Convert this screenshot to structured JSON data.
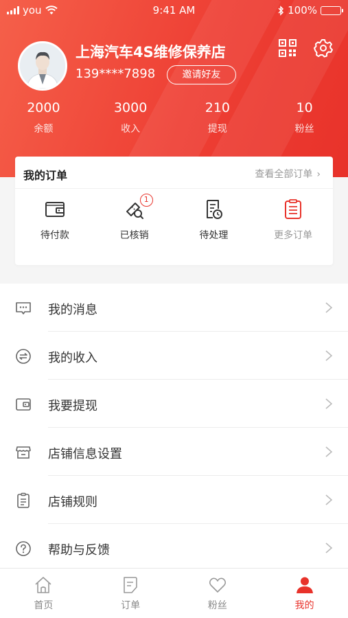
{
  "status_bar": {
    "carrier": "you",
    "time": "9:41 AM",
    "battery": "100%"
  },
  "profile": {
    "shop_name": "上海汽车4S维修保养店",
    "phone": "139****7898",
    "invite_label": "邀请好友"
  },
  "stats": [
    {
      "value": "2000",
      "label": "余额"
    },
    {
      "value": "3000",
      "label": "收入"
    },
    {
      "value": "210",
      "label": "提现"
    },
    {
      "value": "10",
      "label": "粉丝"
    }
  ],
  "orders": {
    "title": "我的订单",
    "view_all": "查看全部订单",
    "items": [
      {
        "label": "待付款",
        "icon": "wallet-icon"
      },
      {
        "label": "已核销",
        "icon": "ticket-check-icon",
        "badge": "1"
      },
      {
        "label": "待处理",
        "icon": "pending-doc-icon"
      },
      {
        "label": "更多订单",
        "icon": "list-doc-icon"
      }
    ]
  },
  "menu": [
    {
      "label": "我的消息",
      "icon": "message-icon"
    },
    {
      "label": "我的收入",
      "icon": "income-icon"
    },
    {
      "label": "我要提现",
      "icon": "withdraw-icon"
    },
    {
      "label": "店铺信息设置",
      "icon": "store-icon"
    },
    {
      "label": "店铺规则",
      "icon": "rules-icon"
    },
    {
      "label": "帮助与反馈",
      "icon": "help-icon"
    }
  ],
  "tabbar": [
    {
      "label": "首页",
      "icon": "home-icon"
    },
    {
      "label": "订单",
      "icon": "order-icon"
    },
    {
      "label": "粉丝",
      "icon": "heart-icon"
    },
    {
      "label": "我的",
      "icon": "user-icon",
      "active": true
    }
  ],
  "colors": {
    "accent": "#e8322a",
    "header_gradient_start": "#f5604a",
    "text": "#333333",
    "muted": "#999999"
  }
}
